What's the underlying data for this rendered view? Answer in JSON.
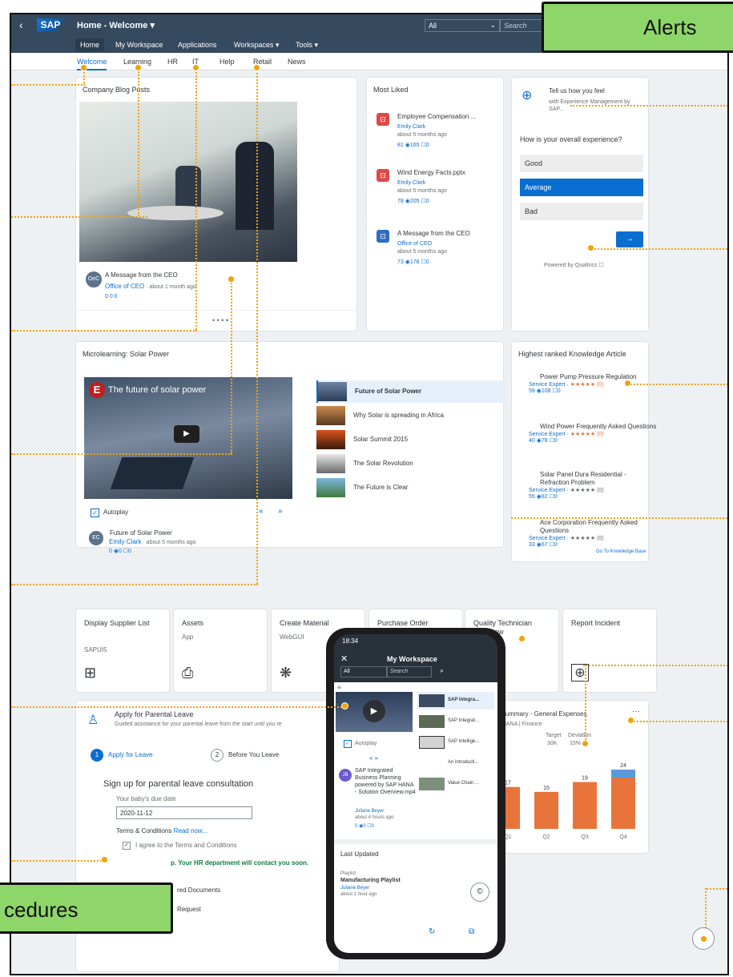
{
  "shell": {
    "title": "Home - Welcome ▾",
    "scope": "All",
    "search_placeholder": "Search"
  },
  "menu": [
    "Home",
    "My Workspace",
    "Applications",
    "Workspaces ▾",
    "Tools ▾"
  ],
  "subtabs": [
    "Welcome",
    "Learning",
    "HR",
    "IT",
    "Help",
    "Retail",
    "News"
  ],
  "blog": {
    "title": "Company Blog Posts",
    "post_title": "A Message from the CEO",
    "author": "Office of CEO",
    "time": " · about 1 month ago",
    "stats": "0  0  0",
    "avatar": "OeC"
  },
  "most_liked": {
    "title": "Most Liked",
    "items": [
      {
        "title": "Employee Compensation ...",
        "author": "Emily Clark",
        "time": "about 5 months ago",
        "stats": "81 ◉165 ☐0",
        "color": "#e04848"
      },
      {
        "title": "Wind Energy Facts.pptx",
        "author": "Emily Clark",
        "time": "about 5 months ago",
        "stats": "78 ◉205 ☐0",
        "color": "#e04848"
      },
      {
        "title": "A Message from the CEO",
        "author": "Office of CEO",
        "time": "about 5 months ago",
        "stats": "73 ◉178 ☐0",
        "color": "#2f6dbf"
      }
    ]
  },
  "survey": {
    "headline": "Tell us how you feel",
    "sub": "with Experience Management by SAP...",
    "question": "How is your overall experience?",
    "options": [
      "Good",
      "Average",
      "Bad"
    ],
    "selected": "Average",
    "submit": "→",
    "powered": "Powered by Qualtrics ☐"
  },
  "microlearning": {
    "title": "Microlearning: Solar Power",
    "video_title": "The future of solar power",
    "playlist": [
      "Future of Solar Power",
      "Why Solar is spreading in Africa",
      "Solar Summit 2015",
      "The Solar Revolution",
      "The Future is Clear"
    ],
    "autoplay": "Autoplay",
    "post_title": "Future of Solar Power",
    "author": "Emily Clark",
    "time": " · about 5 months ago",
    "stats": "0 ◉0 ☐0",
    "avatar": "EC"
  },
  "knowledge": {
    "title": "Highest ranked Knowledge Article",
    "items": [
      {
        "title": "Power Pump Pressure Regulation",
        "author": "Service Expert",
        "stars": "★★★★★ (0)",
        "stats": "59 ◉108 ☐0"
      },
      {
        "title": "Wind Power Frequently Asked Questions",
        "author": "Service Expert",
        "stars": "★★★★★ (0)",
        "stats": "40 ◉78 ☐0"
      },
      {
        "title": "Solar Panel Dura Residential - Refraction Problem",
        "author": "Service Expert",
        "stars": "★★★★★ (0)",
        "stats": "55 ◉82 ☐0"
      },
      {
        "title": "Ace Corporation Frequently Asked Questions",
        "author": "Service Expert",
        "stars": "★★★★★ (0)",
        "stats": "33 ◉67 ☐0"
      }
    ],
    "footer": "Go To Knowledge Base"
  },
  "tiles": [
    {
      "title": "Display Supplier List",
      "sub": "SAPUI5",
      "icon": "⊞"
    },
    {
      "title": "Assets",
      "sub": "App",
      "icon": "⎙"
    },
    {
      "title": "Create Material",
      "sub": "WebGUI",
      "icon": "❋"
    },
    {
      "title": "Purchase Order",
      "sub": "",
      "icon": ""
    },
    {
      "title": "Quality Technician Overview",
      "sub": "",
      "icon": ""
    },
    {
      "title": "Report Incident",
      "sub": "",
      "icon": "⊕"
    }
  ],
  "parental": {
    "title": "Apply for Parental Leave",
    "desc": "Guided assistance for your parental leave from the start until you re",
    "step1": "Apply for Leave",
    "step2": "Before You Leave",
    "section": "Sign up for parental leave consultation",
    "due_label": "Your baby's due date",
    "due_value": "2020-11-12",
    "terms": "Terms & Conditions",
    "read": "Read now...",
    "agree": "I agree to the Terms and Conditions",
    "success": "p. Your HR department will contact you soon.",
    "docs": "red Documents",
    "request": "Request"
  },
  "expenses": {
    "title": "t Summary - General Expenses",
    "sub": "4 HANA | Finance",
    "target_label": "Target",
    "target_value": "30K",
    "dev_label": "Deviation",
    "dev_value": "15%"
  },
  "chart_data": {
    "type": "bar",
    "categories": [
      "Q1",
      "Q2",
      "Q3",
      "Q4"
    ],
    "values": [
      17,
      15,
      19,
      24
    ],
    "ylim": [
      0,
      26
    ],
    "colors": {
      "bar": "#e8743b",
      "highlight": "#5899da"
    }
  },
  "phone": {
    "time": "18:34",
    "title": "My Workspace",
    "scope": "All",
    "search": "Search",
    "playlist": [
      "SAP Integra...",
      "SAP Integrat...",
      "SAP Intellige...",
      "An introducti...",
      "Value Chain ..."
    ],
    "autoplay": "Autoplay",
    "post": "SAP Integrated Business Planning powered by SAP HANA - Solution Overview.mp4",
    "author": "Juliane Beyer",
    "time_ago": "about 4 hours ago",
    "stats": "0 ◉0 ☐0",
    "avatar": "JB",
    "last_updated": "Last Updated",
    "type": "Playlist",
    "pl_title": "Manufacturing Playlist",
    "pl_author": "Juliane Beyer",
    "pl_time": "about 1 hour ago"
  },
  "callouts": {
    "alerts": "Alerts",
    "procedures": "cedures"
  }
}
